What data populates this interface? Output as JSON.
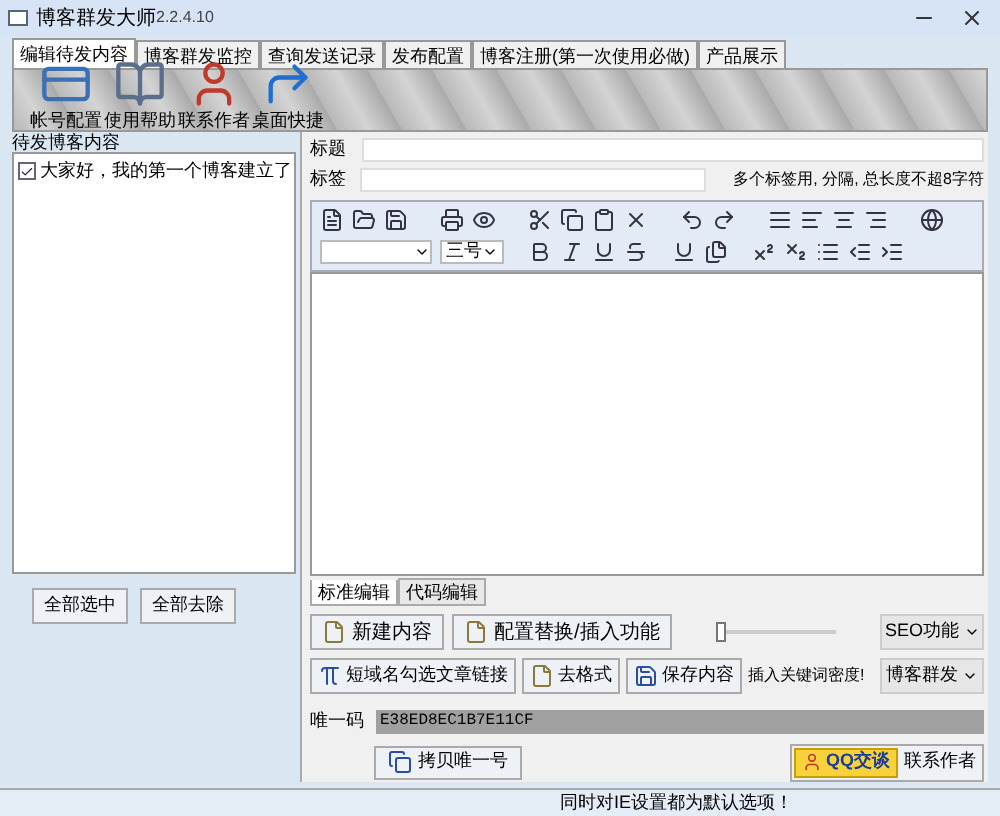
{
  "window": {
    "title": "博客群发大师",
    "version": "2.2.4.10"
  },
  "tabs": [
    {
      "label": "编辑待发内容",
      "selected": true
    },
    {
      "label": "博客群发监控",
      "selected": false
    },
    {
      "label": "查询发送记录",
      "selected": false
    },
    {
      "label": "发布配置",
      "selected": false
    },
    {
      "label": "博客注册(第一次使用必做)",
      "selected": false
    },
    {
      "label": "产品展示",
      "selected": false
    }
  ],
  "toolbar": [
    {
      "label": "帐号配置",
      "kind": "card"
    },
    {
      "label": "使用帮助",
      "kind": "book"
    },
    {
      "label": "联系作者",
      "kind": "person"
    },
    {
      "label": "桌面快捷",
      "kind": "arrow"
    }
  ],
  "left_panel": {
    "title": "待发博客内容",
    "items": [
      {
        "label": "大家好，我的第一个博客建立了",
        "checked": true
      }
    ],
    "buttons": [
      "全部选中",
      "全部去除"
    ]
  },
  "title_field": {
    "label": "标题"
  },
  "tags_field": {
    "label": "标签",
    "hint": "多个标签用, 分隔, 总长度不超8字符"
  },
  "editor": {
    "font_size": "三号"
  },
  "editor_tabs": [
    {
      "label": "标准编辑",
      "selected": true
    },
    {
      "label": "代码编辑",
      "selected": false
    }
  ],
  "actions_row1": [
    {
      "label": "新建内容",
      "kind": "page"
    },
    {
      "label": "配置替换/插入功能",
      "kind": "page"
    }
  ],
  "actions_row2": [
    {
      "label": "短域名勾选文章链接",
      "kind": "pi"
    },
    {
      "label": "去格式",
      "kind": "page"
    },
    {
      "label": "保存内容",
      "kind": "save"
    }
  ],
  "density": {
    "label": "插入关键词密度!",
    "level": 0.05
  },
  "menus": [
    "SEO功能",
    "博客群发"
  ],
  "machine_code": {
    "label": "唯一码",
    "value": "E38ED8EC1B7E11CF"
  },
  "copy_button": "拷贝唯一号",
  "qq_button": "QQ交谈",
  "contact_label": "联系作者",
  "status_bar": "同时对IE设置都为默认选项！"
}
